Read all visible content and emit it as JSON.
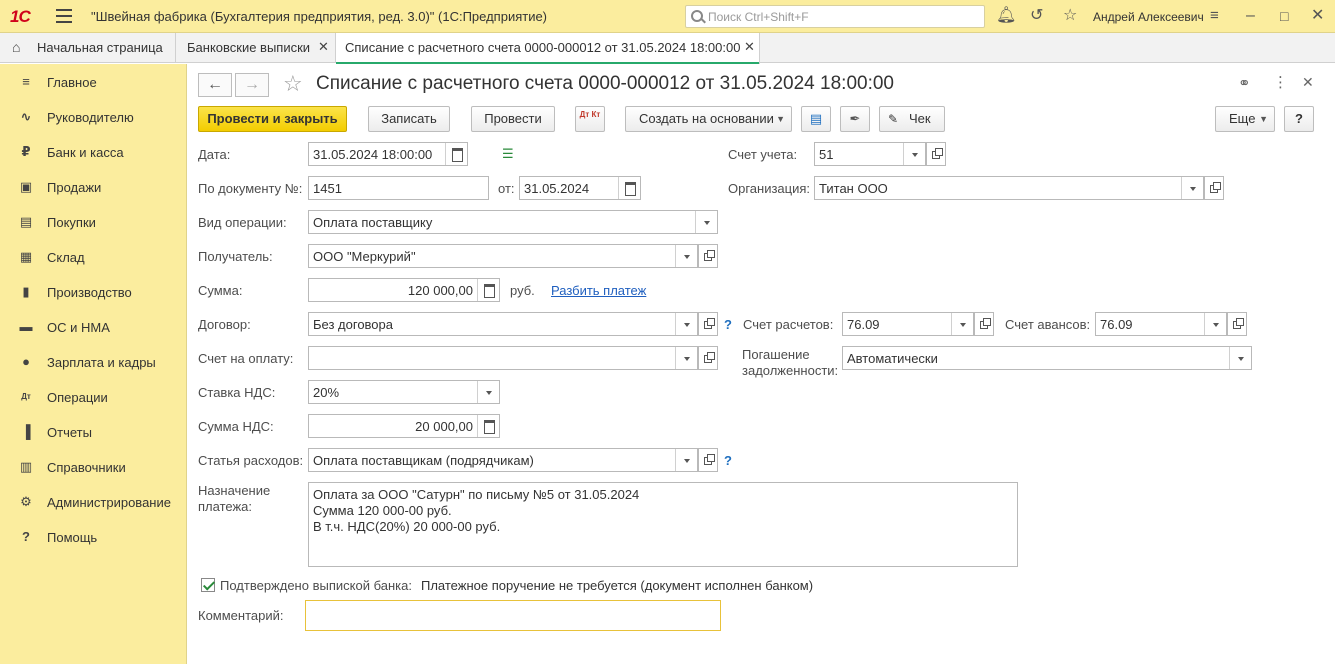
{
  "titlebar": {
    "logo": "1С",
    "app_title": "\"Швейная фабрика (Бухгалтерия предприятия, ред. 3.0)\"  (1С:Предприятие)",
    "search_placeholder": "Поиск Ctrl+Shift+F",
    "user": "Андрей Алексеевич"
  },
  "tabs": [
    {
      "label": "Начальная страница"
    },
    {
      "label": "Банковские выписки"
    },
    {
      "label": "Списание с расчетного счета 0000-000012 от 31.05.2024 18:00:00"
    }
  ],
  "sidebar": {
    "items": [
      {
        "label": "Главное",
        "icon": "menu-lines-icon"
      },
      {
        "label": "Руководителю",
        "icon": "trend-icon"
      },
      {
        "label": "Банк и касса",
        "icon": "coin-icon"
      },
      {
        "label": "Продажи",
        "icon": "bag-icon"
      },
      {
        "label": "Покупки",
        "icon": "cart-icon"
      },
      {
        "label": "Склад",
        "icon": "boxes-icon"
      },
      {
        "label": "Производство",
        "icon": "factory-icon"
      },
      {
        "label": "ОС и НМА",
        "icon": "truck-icon"
      },
      {
        "label": "Зарплата и кадры",
        "icon": "person-icon"
      },
      {
        "label": "Операции",
        "icon": "dt-kt-icon"
      },
      {
        "label": "Отчеты",
        "icon": "bar-chart-icon"
      },
      {
        "label": "Справочники",
        "icon": "books-icon"
      },
      {
        "label": "Администрирование",
        "icon": "gear-icon"
      },
      {
        "label": "Помощь",
        "icon": "question-icon"
      }
    ]
  },
  "document": {
    "title": "Списание с расчетного счета 0000-000012 от 31.05.2024 18:00:00",
    "toolbar": {
      "post_close": "Провести и закрыть",
      "save": "Записать",
      "post": "Провести",
      "dt_kt": "Дт Кт",
      "create_based": "Создать на основании",
      "check": "Чек",
      "more": "Еще",
      "help": "?"
    },
    "fields": {
      "date_label": "Дата:",
      "date_value": "31.05.2024 18:00:00",
      "docnum_label": "По документу №:",
      "docnum_value": "1451",
      "from_label": "от:",
      "from_value": "31.05.2024",
      "optype_label": "Вид операции:",
      "optype_value": "Оплата поставщику",
      "recipient_label": "Получатель:",
      "recipient_value": "ООО \"Меркурий\"",
      "sum_label": "Сумма:",
      "sum_value": "120 000,00",
      "currency": "руб.",
      "split_link": "Разбить платеж",
      "contract_label": "Договор:",
      "contract_value": "Без договора",
      "invoice_label": "Счет на оплату:",
      "invoice_value": "",
      "vat_rate_label": "Ставка НДС:",
      "vat_rate_value": "20%",
      "vat_sum_label": "Сумма НДС:",
      "vat_sum_value": "20 000,00",
      "expense_label": "Статья расходов:",
      "expense_value": "Оплата поставщикам (подрядчикам)",
      "purpose_label1": "Назначение",
      "purpose_label2": "платежа:",
      "purpose_value": "Оплата за ООО \"Сатурн\" по письму №5 от 31.05.2024\nСумма 120 000-00 руб.\nВ т.ч. НДС(20%) 20 000-00 руб.",
      "confirmed_label": "Подтверждено выпиской банка:",
      "confirmed_note": "Платежное поручение не требуется (документ исполнен банком)",
      "comment_label": "Комментарий:",
      "comment_value": "",
      "account_label": "Счет учета:",
      "account_value": "51",
      "org_label": "Организация:",
      "org_value": "Титан ООО",
      "settle_label": "Счет расчетов:",
      "settle_value": "76.09",
      "advance_label": "Счет авансов:",
      "advance_value": "76.09",
      "repay_label1": "Погашение",
      "repay_label2": "задолженности:",
      "repay_value": "Автоматически"
    }
  }
}
